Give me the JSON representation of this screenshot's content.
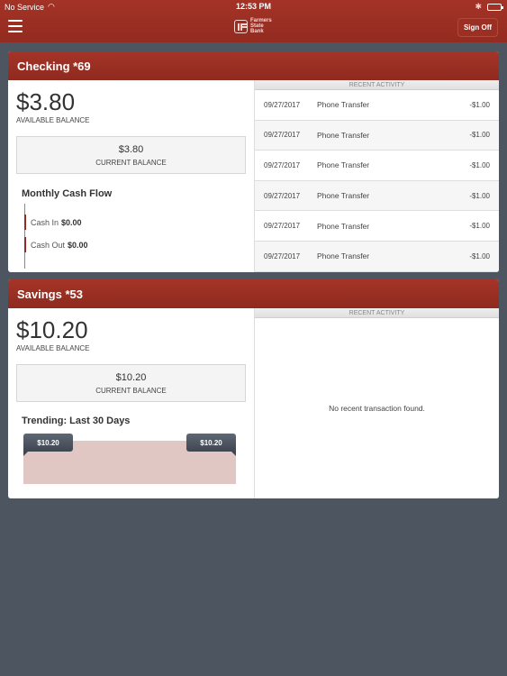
{
  "status_bar": {
    "carrier": "No Service",
    "time": "12:53 PM",
    "battery_level": 0.6
  },
  "header": {
    "logo_lines": [
      "Farmers",
      "State",
      "Bank"
    ],
    "sign_off_label": "Sign Off"
  },
  "accounts": [
    {
      "title": "Checking *69",
      "available_balance": "$3.80",
      "available_label": "AVAILABLE BALANCE",
      "current_balance": "$3.80",
      "current_label": "CURRENT BALANCE",
      "section_title": "Monthly Cash Flow",
      "cash_in_label": "Cash In",
      "cash_in_value": "$0.00",
      "cash_out_label": "Cash Out",
      "cash_out_value": "$0.00",
      "recent_activity_label": "RECENT ACTIVITY",
      "transactions": [
        {
          "date": "09/27/2017",
          "description": "Phone Transfer",
          "amount": "-$1.00"
        },
        {
          "date": "09/27/2017",
          "description": "Phone Transfer",
          "amount": "-$1.00"
        },
        {
          "date": "09/27/2017",
          "description": "Phone Transfer",
          "amount": "-$1.00"
        },
        {
          "date": "09/27/2017",
          "description": "Phone Transfer",
          "amount": "-$1.00"
        },
        {
          "date": "09/27/2017",
          "description": "Phone Transfer",
          "amount": "-$1.00"
        },
        {
          "date": "09/27/2017",
          "description": "Phone Transfer",
          "amount": "-$1.00"
        }
      ]
    },
    {
      "title": "Savings *53",
      "available_balance": "$10.20",
      "available_label": "AVAILABLE BALANCE",
      "current_balance": "$10.20",
      "current_label": "CURRENT BALANCE",
      "section_title": "Trending: Last 30 Days",
      "trend_start": "$10.20",
      "trend_end": "$10.20",
      "recent_activity_label": "RECENT ACTIVITY",
      "empty_message": "No recent transaction found."
    }
  ],
  "colors": {
    "brand": "#9c2f23",
    "background": "#4d5561",
    "trend_fill": "#e1c7c3"
  }
}
